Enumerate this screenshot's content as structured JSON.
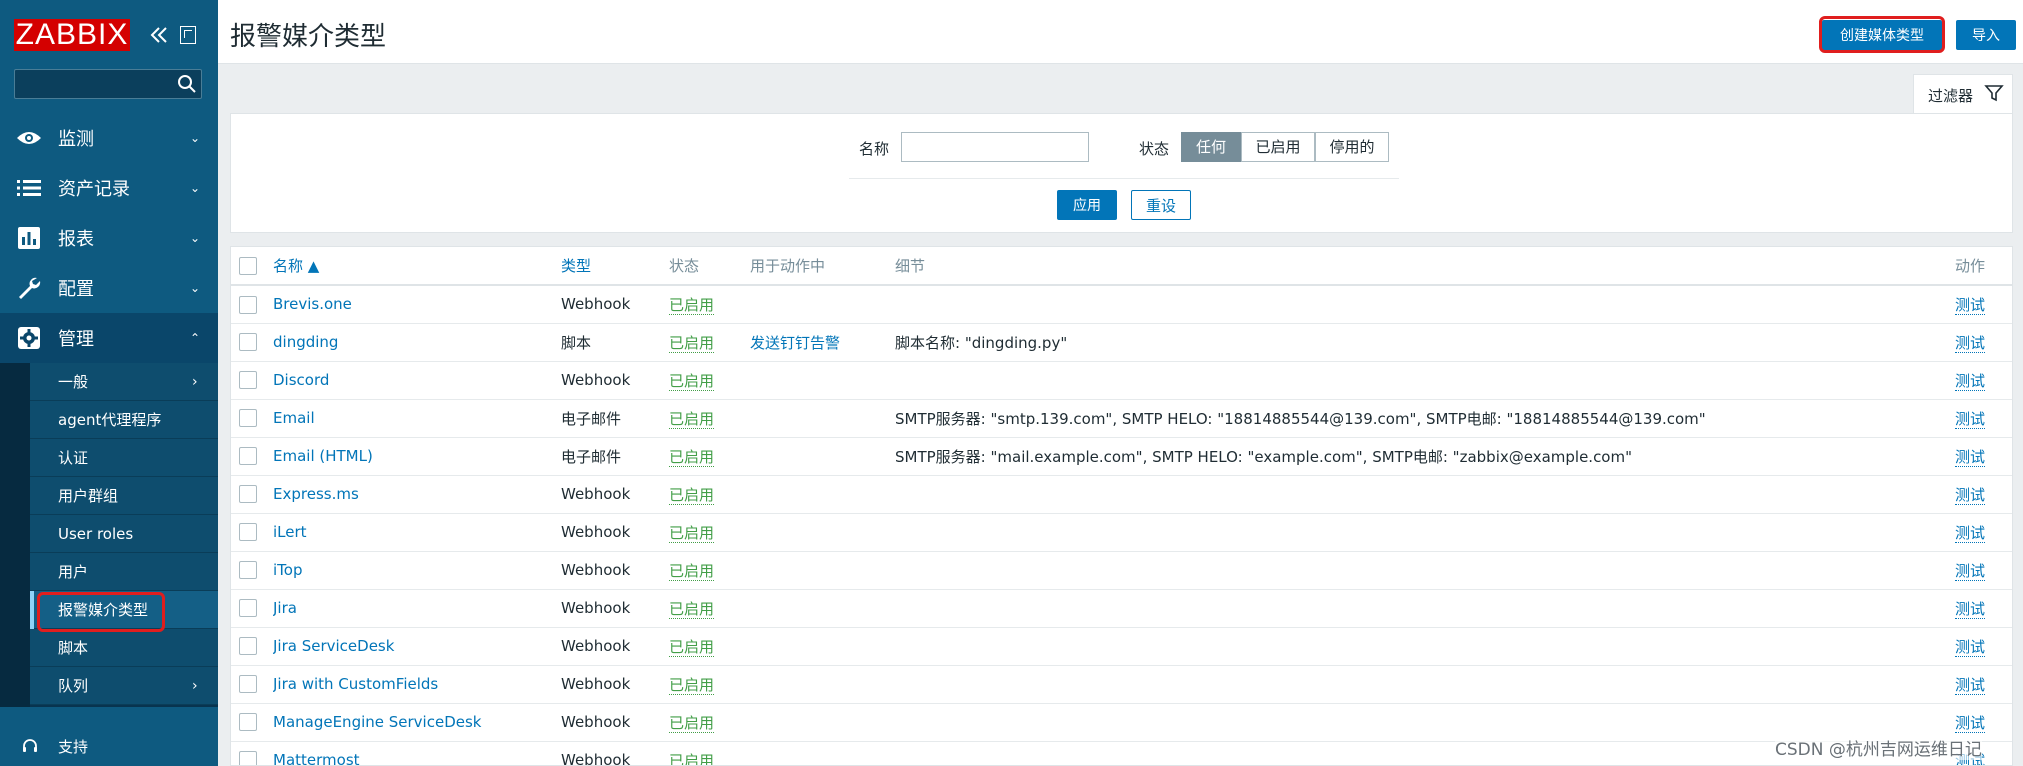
{
  "sidebar": {
    "logo": "ZABBIX",
    "search": {
      "value": "",
      "placeholder": ""
    },
    "menu": [
      {
        "label": "监测",
        "icon": "eye-icon"
      },
      {
        "label": "资产记录",
        "icon": "list-icon"
      },
      {
        "label": "报表",
        "icon": "bar-chart-icon"
      },
      {
        "label": "配置",
        "icon": "wrench-icon"
      },
      {
        "label": "管理",
        "icon": "gear-icon"
      }
    ],
    "submenu": [
      {
        "label": "一般",
        "has_children": true
      },
      {
        "label": "agent代理程序"
      },
      {
        "label": "认证"
      },
      {
        "label": "用户群组"
      },
      {
        "label": "User roles"
      },
      {
        "label": "用户"
      },
      {
        "label": "报警媒介类型",
        "selected": true
      },
      {
        "label": "脚本"
      },
      {
        "label": "队列",
        "has_children": true
      }
    ],
    "support": "支持"
  },
  "header": {
    "title": "报警媒介类型",
    "create_label": "创建媒体类型",
    "import_label": "导入"
  },
  "filter": {
    "tab_label": "过滤器",
    "name_label": "名称",
    "name_value": "",
    "status_label": "状态",
    "status_options": [
      "任何",
      "已启用",
      "停用的"
    ],
    "status_selected": "任何",
    "apply_label": "应用",
    "reset_label": "重设"
  },
  "table": {
    "columns": {
      "name": "名称 ▲",
      "type": "类型",
      "status": "状态",
      "used_in_actions": "用于动作中",
      "details": "细节",
      "action": "动作"
    },
    "rows": [
      {
        "name": "Brevis.one",
        "type": "Webhook",
        "status": "已启用",
        "actions": "",
        "details": "",
        "test": "测试"
      },
      {
        "name": "dingding",
        "type": "脚本",
        "status": "已启用",
        "actions": "发送钉钉告警",
        "details": "脚本名称: \"dingding.py\"",
        "test": "测试"
      },
      {
        "name": "Discord",
        "type": "Webhook",
        "status": "已启用",
        "actions": "",
        "details": "",
        "test": "测试"
      },
      {
        "name": "Email",
        "type": "电子邮件",
        "status": "已启用",
        "actions": "",
        "details": "SMTP服务器: \"smtp.139.com\", SMTP HELO: \"18814885544@139.com\", SMTP电邮: \"18814885544@139.com\"",
        "test": "测试"
      },
      {
        "name": "Email (HTML)",
        "type": "电子邮件",
        "status": "已启用",
        "actions": "",
        "details": "SMTP服务器: \"mail.example.com\", SMTP HELO: \"example.com\", SMTP电邮: \"zabbix@example.com\"",
        "test": "测试"
      },
      {
        "name": "Express.ms",
        "type": "Webhook",
        "status": "已启用",
        "actions": "",
        "details": "",
        "test": "测试"
      },
      {
        "name": "iLert",
        "type": "Webhook",
        "status": "已启用",
        "actions": "",
        "details": "",
        "test": "测试"
      },
      {
        "name": "iTop",
        "type": "Webhook",
        "status": "已启用",
        "actions": "",
        "details": "",
        "test": "测试"
      },
      {
        "name": "Jira",
        "type": "Webhook",
        "status": "已启用",
        "actions": "",
        "details": "",
        "test": "测试"
      },
      {
        "name": "Jira ServiceDesk",
        "type": "Webhook",
        "status": "已启用",
        "actions": "",
        "details": "",
        "test": "测试"
      },
      {
        "name": "Jira with CustomFields",
        "type": "Webhook",
        "status": "已启用",
        "actions": "",
        "details": "",
        "test": "测试"
      },
      {
        "name": "ManageEngine ServiceDesk",
        "type": "Webhook",
        "status": "已启用",
        "actions": "",
        "details": "",
        "test": "测试"
      },
      {
        "name": "Mattermost",
        "type": "Webhook",
        "status": "已启用",
        "actions": "",
        "details": "",
        "test": "测试"
      }
    ]
  },
  "watermark": "CSDN @杭州吉网运维日记",
  "colors": {
    "sidebar": "#0e5a80",
    "accent": "#0275b8",
    "enabled": "#429e47",
    "highlight": "#e01e1e",
    "logo": "#d40000"
  }
}
